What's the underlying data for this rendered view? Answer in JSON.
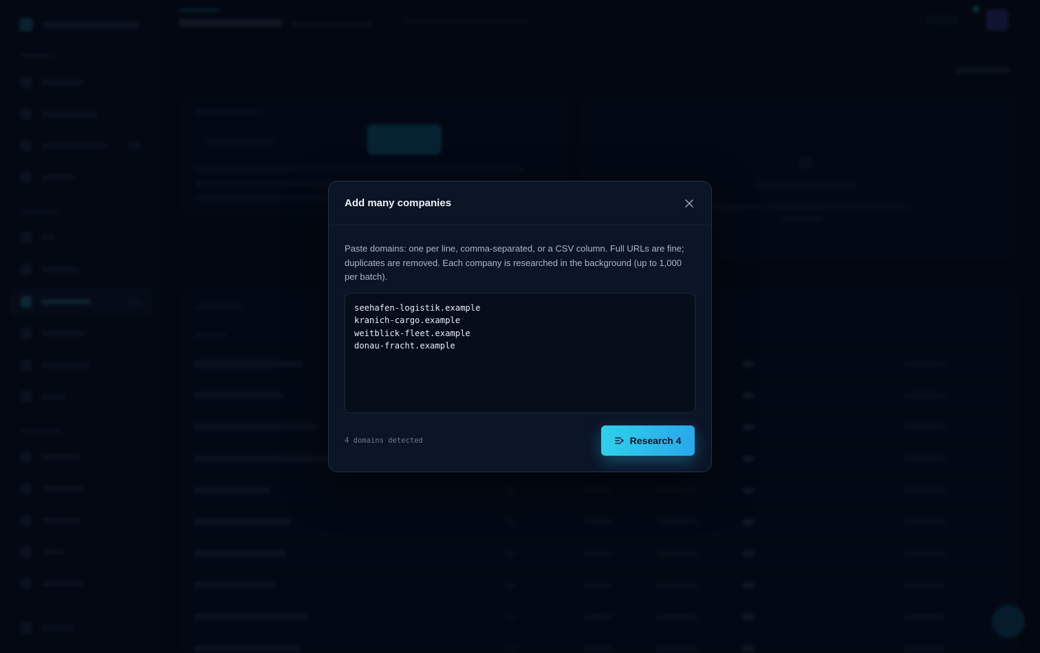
{
  "modal": {
    "title": "Add many companies",
    "description": "Paste domains: one per line, comma-separated, or a CSV column. Full URLs are fine; duplicates are removed. Each company is researched in the background (up to 1,000 per batch).",
    "domains_text": "seehafen-logistik.example\nkranich-cargo.example\nweitblick-fleet.example\ndonau-fracht.example",
    "detected_label": "4 domains detected",
    "submit_label": "Research 4",
    "close_icon": "close-icon",
    "submit_icon": "list-arrow-icon"
  },
  "colors": {
    "accent_start": "#2fd0ea",
    "accent_end": "#2aa8ec",
    "modal_bg": "#0b1526"
  }
}
